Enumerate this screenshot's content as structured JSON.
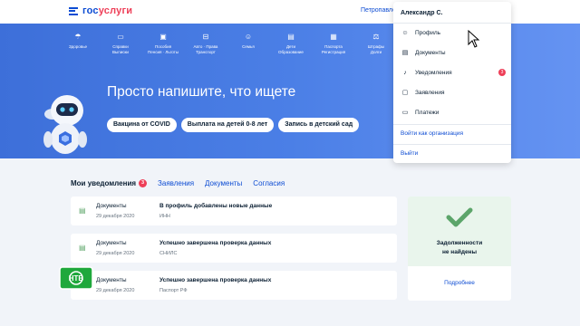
{
  "header": {
    "logo_part1": "гос",
    "logo_part2": "услуги",
    "city": "Петропавловск"
  },
  "categories": [
    {
      "icon": "☂",
      "label": "Здоровье"
    },
    {
      "icon": "▭",
      "label": "Справки\nВыписки"
    },
    {
      "icon": "▣",
      "label": "Пособия\nПенсия · Льготы"
    },
    {
      "icon": "⊟",
      "label": "Авто · Права\nТранспорт"
    },
    {
      "icon": "☺",
      "label": "Семья"
    },
    {
      "icon": "▤",
      "label": "Дети\nОбразование"
    },
    {
      "icon": "▦",
      "label": "Паспорта\nРегистрация"
    },
    {
      "icon": "⚖",
      "label": "Штрафы\nДолги"
    }
  ],
  "hero": {
    "title": "Просто напишите, что ищете",
    "chips": [
      "Вакцина от COVID",
      "Выплата на детей 0-8 лет",
      "Запись в детский сад"
    ]
  },
  "tabs": {
    "notifications": "Мои уведомления",
    "notifications_count": "3",
    "applications": "Заявления",
    "documents": "Документы",
    "consents": "Согласия"
  },
  "notifications": [
    {
      "type": "Документы",
      "date": "29 декабря 2020",
      "title": "В профиль добавлены новые данные",
      "sub": "ИНН"
    },
    {
      "type": "Документы",
      "date": "29 декабря 2020",
      "title": "Успешно завершена проверка данных",
      "sub": "СНИЛС"
    },
    {
      "type": "Документы",
      "date": "29 декабря 2020",
      "title": "Успешно завершена проверка данных",
      "sub": "Паспорт РФ"
    }
  ],
  "debt": {
    "text": "Задолженности\nне найдены",
    "more": "Подробнее"
  },
  "menu": {
    "user": "Александр С.",
    "items": [
      {
        "icon": "☺",
        "label": "Профиль"
      },
      {
        "icon": "▤",
        "label": "Документы"
      },
      {
        "icon": "♪",
        "label": "Уведомления",
        "badge": "3"
      },
      {
        "icon": "▢",
        "label": "Заявления"
      },
      {
        "icon": "▭",
        "label": "Платежи"
      }
    ],
    "org_link": "Войти как организация",
    "logout": "Выйти"
  },
  "overlay": {
    "channel_logo": "НТВ"
  },
  "colors": {
    "brand_blue": "#0d4cd3",
    "brand_red": "#ee3f58",
    "hero_blue": "#4b7fe6",
    "success_green": "#5ca56a"
  }
}
